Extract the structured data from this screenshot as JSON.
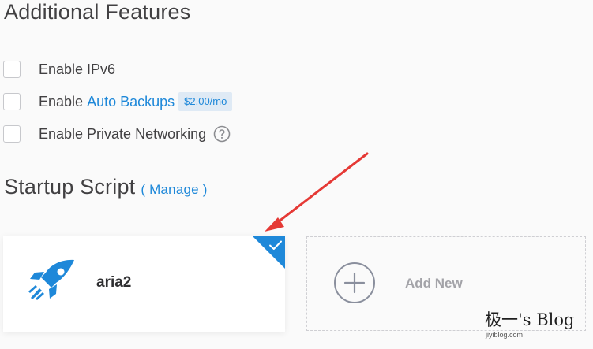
{
  "features": {
    "title": "Additional Features",
    "options": [
      {
        "label": "Enable IPv6",
        "checked": false
      },
      {
        "label_prefix": "Enable",
        "link": "Auto Backups",
        "badge": "$2.00/mo",
        "checked": false
      },
      {
        "label": "Enable Private Networking",
        "help_icon": "question-circle-icon",
        "checked": false
      }
    ]
  },
  "startup": {
    "title": "Startup Script",
    "manage_link": "( Manage )",
    "selected_script": {
      "name": "aria2",
      "icon": "rocket-icon",
      "selected": true,
      "accent": "#1e88d9"
    },
    "add_new": {
      "label": "Add New",
      "icon": "plus-circle-icon"
    }
  },
  "watermark": {
    "title": "极一's Blog",
    "url": "jiyiblog.com"
  },
  "colors": {
    "accent": "#1e88d9",
    "annotation_arrow": "#e53935"
  }
}
